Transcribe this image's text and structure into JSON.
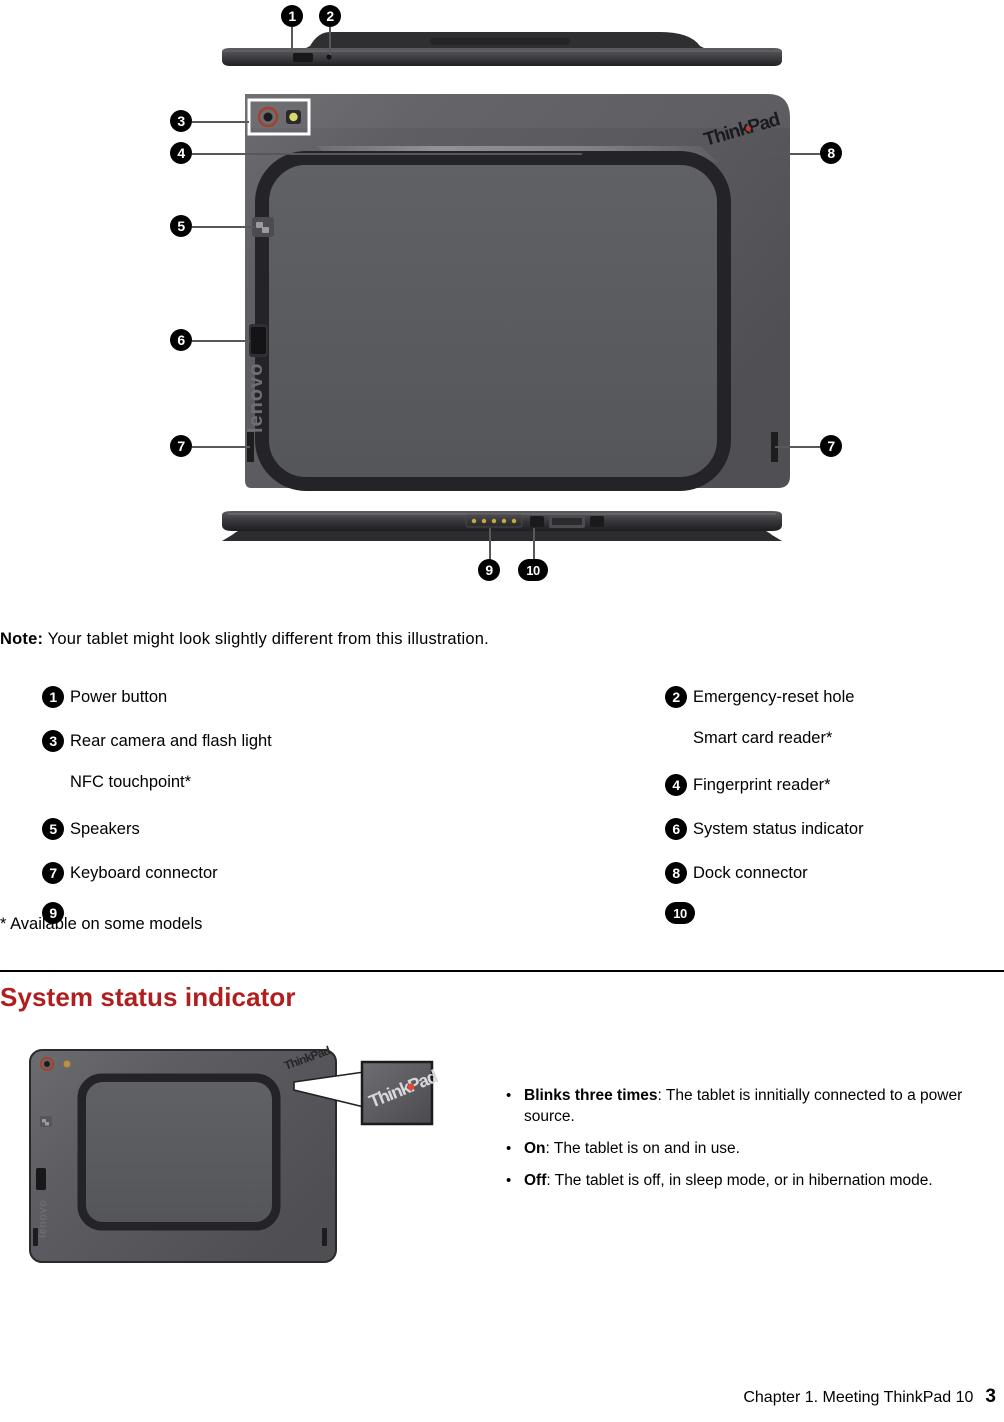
{
  "note": {
    "label": "Note:",
    "text": "Your tablet might look slightly different from this illustration."
  },
  "legend": {
    "left_column": [
      {
        "marker": "1",
        "label": "Power button"
      },
      {
        "marker": "3",
        "label": "Rear camera and flash light"
      },
      {
        "marker": "",
        "label": "NFC touchpoint*"
      },
      {
        "marker": "5",
        "label": "Speakers"
      },
      {
        "marker": "7",
        "label": "Keyboard connector"
      },
      {
        "marker": "9",
        "label": ""
      }
    ],
    "right_column": [
      {
        "marker": "2",
        "label": "Emergency-reset hole"
      },
      {
        "marker": "",
        "label": "Smart card reader*"
      },
      {
        "marker": "4",
        "label": "Fingerprint reader*"
      },
      {
        "marker": "6",
        "label": "System status indicator"
      },
      {
        "marker": "8",
        "label": "Dock connector"
      },
      {
        "marker": "10",
        "label": ""
      }
    ]
  },
  "footnote": "* Available on some models",
  "section": {
    "heading": "System status indicator",
    "heading_color": "#b01f1f"
  },
  "status_bullets": [
    {
      "bullet": "•",
      "term": "Blinks three times",
      "rest": ": The tablet is innitially connected to a power source."
    },
    {
      "bullet": "•",
      "term": "On",
      "rest": ": The tablet is on and in use."
    },
    {
      "bullet": "•",
      "term": "Off",
      "rest": ": The tablet is off, in sleep mode, or in hibernation mode."
    }
  ],
  "illustration": {
    "main_callouts": [
      "1",
      "2",
      "3",
      "4",
      "5",
      "6",
      "7",
      "7",
      "8",
      "9",
      "10"
    ],
    "brand_thinkpad": "ThinkPad",
    "brand_lenovo": "lenovo",
    "body_color": "#5b5b60",
    "panel_color": "#5a5c60",
    "edge_color": "#2b2b2e"
  },
  "footer": {
    "text": "Chapter 1.  Meeting ThinkPad 10",
    "page": "3"
  }
}
